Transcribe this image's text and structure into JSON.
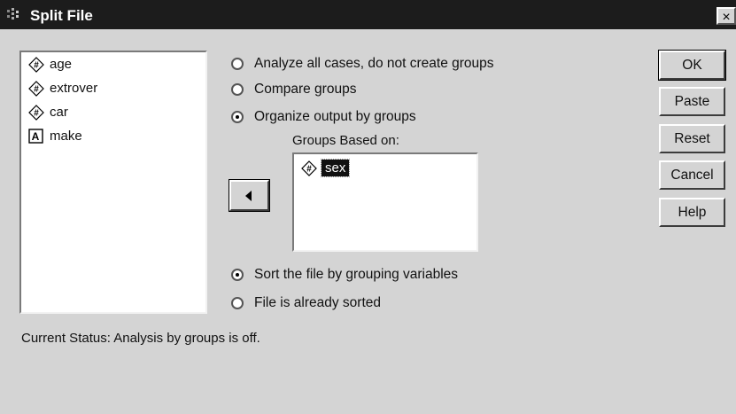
{
  "window": {
    "title": "Split File",
    "close_glyph": "×"
  },
  "variables": [
    {
      "name": "age",
      "icon": "numeric-variable-icon"
    },
    {
      "name": "extrover",
      "icon": "numeric-variable-icon"
    },
    {
      "name": "car",
      "icon": "numeric-variable-icon"
    },
    {
      "name": "make",
      "icon": "string-variable-icon"
    }
  ],
  "mode_options": [
    {
      "label": "Analyze all cases, do not create groups",
      "selected": false
    },
    {
      "label": "Compare groups",
      "selected": false
    },
    {
      "label": "Organize output by groups",
      "selected": true
    }
  ],
  "groups": {
    "label": "Groups Based on:",
    "items": [
      {
        "name": "sex",
        "icon": "numeric-variable-icon",
        "selected": true
      }
    ]
  },
  "sort_options": [
    {
      "label": "Sort the file by grouping variables",
      "selected": true
    },
    {
      "label": "File is already sorted",
      "selected": false
    }
  ],
  "buttons": {
    "ok": "OK",
    "paste": "Paste",
    "reset": "Reset",
    "cancel": "Cancel",
    "help": "Help"
  },
  "status": "Current Status:  Analysis by groups is off."
}
